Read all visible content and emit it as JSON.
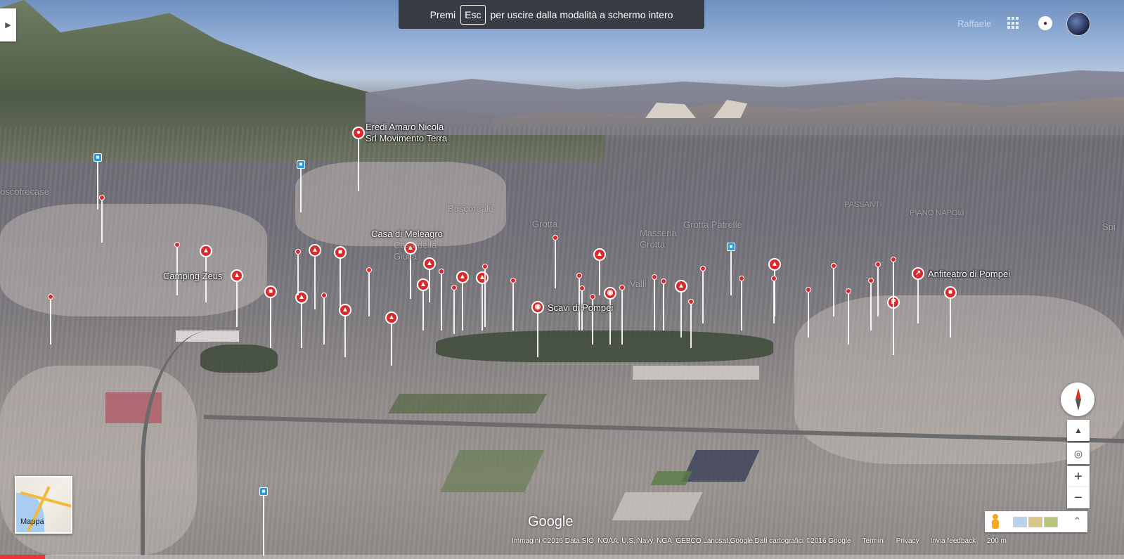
{
  "banner": {
    "prefix": "Premi",
    "key": "Esc",
    "suffix": "per uscire dalla modalità a schermo intero"
  },
  "header": {
    "signin": "Raffaele"
  },
  "places": {
    "eredi": "Eredi Amaro Nicola\nSrl Movimento Terra",
    "boscotrecase": "oscotrecase",
    "boscoreale": "Boscoreale",
    "passanti": "PASSANTI",
    "piano_napoli": "PIANO NAPOLI",
    "spi": "Spi",
    "grotta": "Grotta",
    "grotta_patrelle": "Grotta Patrelle",
    "masseria_grotta": "Masseria\nGrotta",
    "casa_meleagro": "Casa di Meleagro",
    "casa_della": "Casa della\nGiulia",
    "valli": "Valli",
    "camping_zeus": "Camping Zeus",
    "scavi": "Scavi di Pompei",
    "anfiteatro": "Anfiteatro di Pompei"
  },
  "minimap": {
    "label": "Mappa"
  },
  "logo": "Google",
  "footer": {
    "attribution": "Immagini ©2016 Data SIO, NOAA, U.S. Navy, NGA, GEBCO,Landsat,Google,Dati cartografici ©2016 Google",
    "terms": "Termini",
    "privacy": "Privacy",
    "feedback": "Invia feedback",
    "scale": "200 m"
  },
  "colors": {
    "pin_red": "#d9292b",
    "pin_blue": "#2d9ad8",
    "progress": "#e53935"
  },
  "icons": {
    "compass": "compass-icon",
    "pegman": "pegman-icon",
    "apps": "apps-grid-icon",
    "notifications": "bell-icon"
  },
  "playback_progress": 0.04
}
